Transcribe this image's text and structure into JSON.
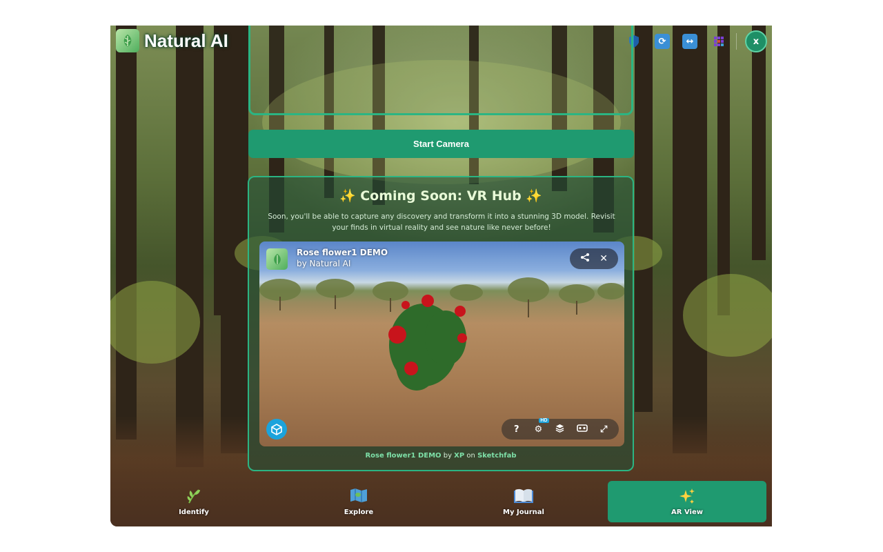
{
  "app": {
    "brand_name": "Natural AI"
  },
  "header": {
    "icons": [
      "shield-icon",
      "sync-icon",
      "swap-icon",
      "grid-icon"
    ],
    "close_label": "x"
  },
  "camera": {
    "start_label": "Start Camera"
  },
  "vr_hub": {
    "title": "✨ Coming Soon: VR Hub ✨",
    "description": "Soon, you'll be able to capture any discovery and transform it into a stunning 3D model. Revisit your finds in virtual reality and see nature like never before!",
    "viewer": {
      "model_title": "Rose flower1 DEMO",
      "model_author": "by Natural AI",
      "hd_badge": "HD",
      "controls": [
        "help-icon",
        "settings-icon",
        "layers-icon",
        "vr-icon",
        "fullscreen-icon"
      ]
    },
    "credit": {
      "model": "Rose flower1 DEMO",
      "by": "by",
      "author": "XP",
      "on": "on",
      "platform": "Sketchfab"
    }
  },
  "nav": {
    "items": [
      {
        "label": "Identify",
        "icon": "leaf-icon"
      },
      {
        "label": "Explore",
        "icon": "map-icon"
      },
      {
        "label": "My Journal",
        "icon": "book-icon"
      },
      {
        "label": "AR View",
        "icon": "sparkles-icon",
        "active": true
      }
    ]
  },
  "colors": {
    "accent": "#1f9a70",
    "border": "#2bb583",
    "title_text": "#e9fbd8"
  }
}
